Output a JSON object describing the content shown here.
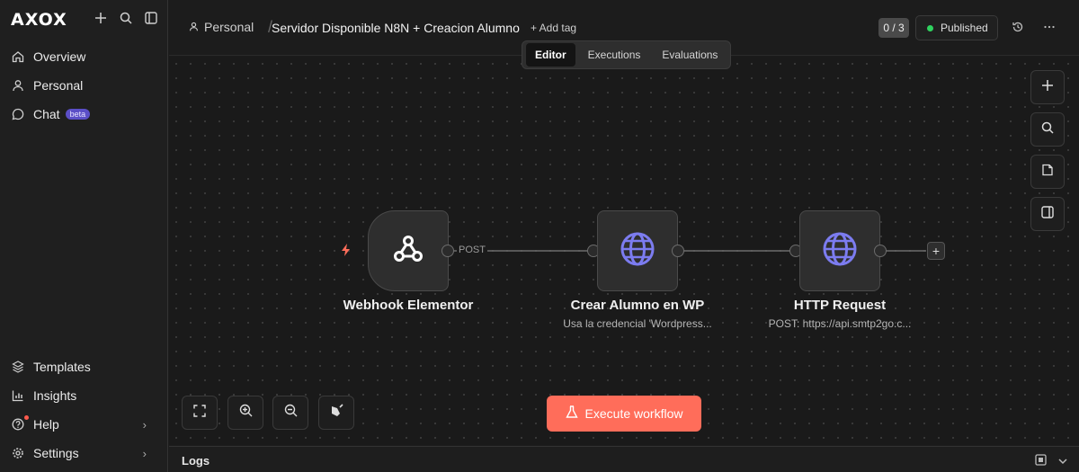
{
  "sidebar": {
    "logo": "AXOX",
    "top_icons": [
      "plus-icon",
      "search-icon",
      "panel-toggle-icon"
    ],
    "items": [
      {
        "label": "Overview",
        "icon": "home-icon"
      },
      {
        "label": "Personal",
        "icon": "user-icon"
      },
      {
        "label": "Chat",
        "icon": "chat-icon",
        "badge": "beta"
      }
    ],
    "bottom_items": [
      {
        "label": "Templates",
        "icon": "templates-icon"
      },
      {
        "label": "Insights",
        "icon": "chart-icon"
      },
      {
        "label": "Help",
        "icon": "help-icon"
      },
      {
        "label": "Settings",
        "icon": "gear-icon"
      }
    ]
  },
  "header": {
    "project": "Personal",
    "workflow_name": "Servidor Disponible N8N + Creacion Alumno",
    "add_tag": "+ Add tag",
    "tabs": [
      "Editor",
      "Executions",
      "Evaluations"
    ],
    "active_tab": "Editor",
    "counter": "0 / 3",
    "status": "Published",
    "status_color": "#2fd35f"
  },
  "canvas": {
    "nodes": [
      {
        "title": "Webhook Elementor",
        "subtitle": "",
        "icon": "webhook-icon"
      },
      {
        "title": "Crear Alumno en WP",
        "subtitle": "Usa la credencial 'Wordpress...",
        "icon": "globe-icon"
      },
      {
        "title": "HTTP Request",
        "subtitle": "POST: https://api.smtp2go.c...",
        "icon": "globe-icon"
      }
    ],
    "connection_label": "POST",
    "execute_label": "Execute workflow",
    "accent_color": "#ff6d5a"
  },
  "logs": {
    "label": "Logs"
  }
}
